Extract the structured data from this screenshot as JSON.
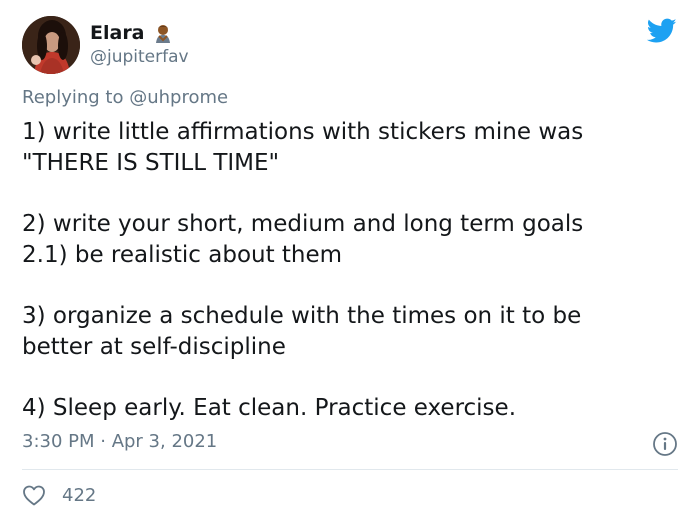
{
  "tweet": {
    "author": {
      "display_name": "Elara",
      "handle": "@jupiterfav",
      "avatar_icon": "avatar-photo",
      "name_emoji": "person-bowing-emoji"
    },
    "brand_icon": "twitter-bird-icon",
    "brand_color": "#1da1f2",
    "reply": {
      "prefix": "Replying to",
      "mention": "@uhprome"
    },
    "body": "1) write little affirmations with stickers mine was\n\"THERE IS STILL TIME\"\n\n2) write your short, medium and long term goals\n2.1) be realistic about them\n\n3) organize a schedule with the times on it to be\nbetter at self-discipline\n\n4) Sleep early. Eat clean. Practice exercise.",
    "timestamp": "3:30 PM · Apr 3, 2021",
    "info_icon": "info-icon",
    "likes": {
      "icon": "heart-icon",
      "count": "422"
    }
  }
}
